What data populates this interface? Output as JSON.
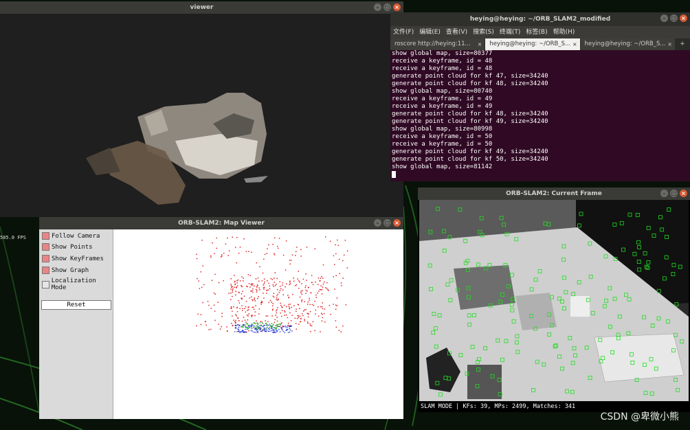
{
  "viewer": {
    "title": "viewer",
    "fps": "505.0 FPS"
  },
  "terminal": {
    "title": "heying@heying: ~/ORB_SLAM2_modified",
    "menu": [
      "文件(F)",
      "编辑(E)",
      "查看(V)",
      "搜索(S)",
      "终端(T)",
      "标签(B)",
      "帮助(H)"
    ],
    "tabs": [
      {
        "label": "roscore http://heying:11..."
      },
      {
        "label": "heying@heying: ~/ORB_S..."
      },
      {
        "label": "heying@heying: ~/ORB_S..."
      }
    ],
    "new_tab": "+",
    "lines": [
      "show global map, size=80377",
      "receive a keyframe, id = 48",
      "receive a keyframe, id = 48",
      "generate point cloud for kf 47, size=34240",
      "generate point cloud for kf 48, size=34240",
      "show global map, size=80740",
      "receive a keyframe, id = 49",
      "receive a keyframe, id = 49",
      "generate point cloud for kf 48, size=34240",
      "generate point cloud for kf 49, size=34240",
      "show global map, size=80998",
      "receive a keyframe, id = 50",
      "receive a keyframe, id = 50",
      "generate point cloud for kf 49, size=34240",
      "generate point cloud for kf 50, size=34240",
      "show global map, size=81142"
    ]
  },
  "frame": {
    "title": "ORB-SLAM2: Current Frame",
    "status": "SLAM MODE |  KFs: 39, MPs: 2499, Matches: 341"
  },
  "map": {
    "title": "ORB-SLAM2: Map Viewer",
    "options": [
      {
        "label": "Follow Camera",
        "checked": true
      },
      {
        "label": "Show Points",
        "checked": true
      },
      {
        "label": "Show KeyFrames",
        "checked": true
      },
      {
        "label": "Show Graph",
        "checked": true
      },
      {
        "label": "Localization Mode",
        "checked": false
      }
    ],
    "reset_label": "Reset"
  },
  "window_buttons": {
    "minimize": "–",
    "maximize": "□",
    "close": "×"
  },
  "watermark": "CSDN @卑微小熊",
  "colors": {
    "map_points": "#e02020",
    "keyframes": "#2030d0",
    "graph": "#20b020",
    "features": "#22dd22",
    "terminal_bg": "#300a24"
  }
}
